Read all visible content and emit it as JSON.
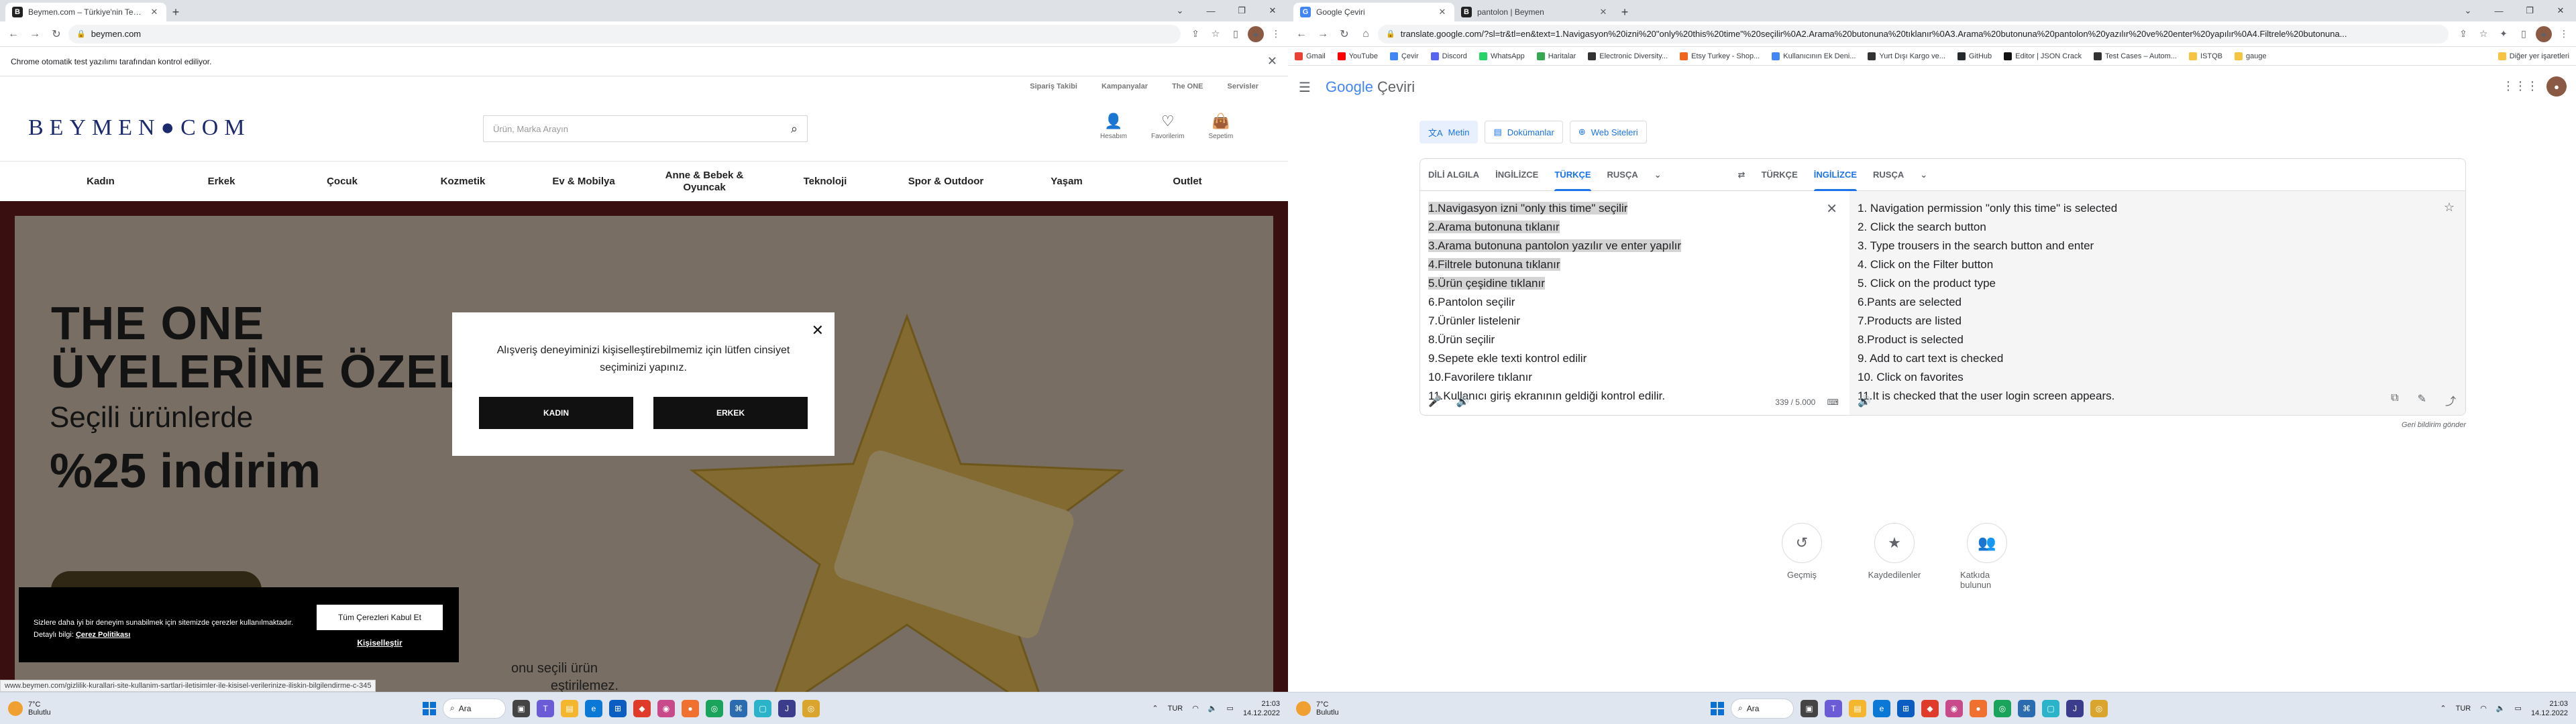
{
  "left": {
    "tabs": [
      {
        "title": "Beymen.com – Türkiye'nin Tek C...",
        "favicon": "B"
      }
    ],
    "address": "beymen.com",
    "infobar": "Chrome otomatik test yazılımı tarafından kontrol ediliyor.",
    "top_links": [
      "Sipariş Takibi",
      "Kampanyalar",
      "The ONE",
      "Servisler"
    ],
    "logo": "BEYMEN●COM",
    "search_placeholder": "Ürün, Marka Arayın",
    "header_icons": [
      {
        "label": "Hesabım",
        "icon": "user-icon"
      },
      {
        "label": "Favorilerim",
        "icon": "heart-icon"
      },
      {
        "label": "Sepetim",
        "icon": "bag-icon"
      }
    ],
    "nav": [
      "Kadın",
      "Erkek",
      "Çocuk",
      "Kozmetik",
      "Ev & Mobilya",
      "Anne & Bebek & Oyuncak",
      "Teknoloji",
      "Spor & Outdoor",
      "Yaşam",
      "Outlet"
    ],
    "hero": {
      "title_line1": "THE ONE",
      "title_line2": "ÜYELERİNE ÖZEL",
      "subtitle": "Seçili ürünlerde",
      "percent": "%25 indirim",
      "footer_line1": "onu seçili ürün",
      "footer_line2": "eştirilemez."
    },
    "modal": {
      "message": "Alışveriş deneyiminizi kişiselleştirebilmemiz için lütfen cinsiyet seçiminizi yapınız.",
      "button_female": "KADIN",
      "button_male": "ERKEK"
    },
    "cookie": {
      "text": "Sizlere daha iyi bir deneyim sunabilmek için sitemizde çerezler kullanılmaktadır. Detaylı bilgi:",
      "policy_link": "Çerez Politikası",
      "accept": "Tüm Çerezleri Kabul Et",
      "customize": "Kişiselleştir"
    },
    "status_url": "www.beymen.com/gizlilik-kurallari-site-kullanim-sartlari-iletisimler-ile-kisisel-verilerinize-iliskin-bilgilendirme-c-345",
    "taskbar": {
      "temp": "7°C",
      "weather": "Bulutlu",
      "search": "Ara",
      "lang": "TUR",
      "time": "21:03",
      "date": "14.12.2022"
    }
  },
  "right": {
    "tabs": [
      {
        "title": "Google Çeviri",
        "favicon": "G"
      },
      {
        "title": "pantolon | Beymen",
        "favicon": "B"
      }
    ],
    "address": "translate.google.com/?sl=tr&tl=en&text=1.Navigasyon%20izni%20\"only%20this%20time\"%20seçilir%0A2.Arama%20butonuna%20tıklanır%0A3.Arama%20butonuna%20pantolon%20yazılır%20ve%20enter%20yapılır%0A4.Filtrele%20butonuna...",
    "bookmarks": [
      {
        "label": "Gmail",
        "color": "#ea4335"
      },
      {
        "label": "YouTube",
        "color": "#ff0000"
      },
      {
        "label": "Çevir",
        "color": "#4285f4"
      },
      {
        "label": "Discord",
        "color": "#5865f2"
      },
      {
        "label": "WhatsApp",
        "color": "#25d366"
      },
      {
        "label": "Haritalar",
        "color": "#34a853"
      },
      {
        "label": "Electronic Diversity...",
        "color": "#333333"
      },
      {
        "label": "Etsy Turkey - Shop...",
        "color": "#f1641e"
      },
      {
        "label": "Kullanıcının Ek Deni...",
        "color": "#4285f4"
      },
      {
        "label": "Yurt Dışı Kargo ve...",
        "color": "#333333"
      },
      {
        "label": "GitHub",
        "color": "#24292e"
      },
      {
        "label": "Editor | JSON Crack",
        "color": "#111111"
      },
      {
        "label": "Test Cases – Autom...",
        "color": "#333333"
      },
      {
        "label": "ISTQB",
        "color": "#f5c542"
      },
      {
        "label": "gauge",
        "color": "#f5c542"
      }
    ],
    "bookmarks_other": "Diğer yer işaretleri",
    "logo_google": "Google",
    "logo_product": "Çeviri",
    "modes": [
      {
        "label": "Metin",
        "icon": "text-icon"
      },
      {
        "label": "Dokümanlar",
        "icon": "document-icon"
      },
      {
        "label": "Web Siteleri",
        "icon": "globe-icon"
      }
    ],
    "src_langs": [
      "DİLİ ALGILA",
      "İNGİLİZCE",
      "TÜRKÇE",
      "RUSÇA"
    ],
    "dst_langs": [
      "TÜRKÇE",
      "İNGİLİZCE",
      "RUSÇA"
    ],
    "source_lines": [
      "1.Navigasyon izni \"only this time\" seçilir",
      "2.Arama butonuna tıklanır",
      "3.Arama butonuna pantolon yazılır ve enter yapılır",
      "4.Filtrele butonuna tıklanır",
      "5.Ürün çeşidine tıklanır",
      "6.Pantolon seçilir",
      "7.Ürünler listelenir",
      "8.Ürün seçilir",
      "9.Sepete ekle texti kontrol edilir",
      "10.Favorilere tıklanır",
      "11.Kullanıcı giriş ekranının geldiği kontrol edilir."
    ],
    "highlighted_count": 5,
    "target_lines": [
      "1. Navigation permission \"only this time\" is selected",
      "2. Click the search button",
      "3. Type trousers in the search button and enter",
      "4. Click on the Filter button",
      "5. Click on the product type",
      "6.Pants are selected",
      "7.Products are listed",
      "8.Product is selected",
      "9. Add to cart text is checked",
      "10. Click on favorites",
      "11.It is checked that the user login screen appears."
    ],
    "char_count": "339 / 5.000",
    "feedback": "Geri bildirim gönder",
    "bottom_actions": [
      {
        "label": "Geçmiş",
        "icon": "history-icon"
      },
      {
        "label": "Kaydedilenler",
        "icon": "star-icon"
      },
      {
        "label": "Katkıda bulunun",
        "icon": "contribute-icon"
      }
    ],
    "taskbar": {
      "temp": "7°C",
      "weather": "Bulutlu",
      "search": "Ara",
      "lang": "TUR",
      "time": "21:03",
      "date": "14.12.2022"
    }
  }
}
